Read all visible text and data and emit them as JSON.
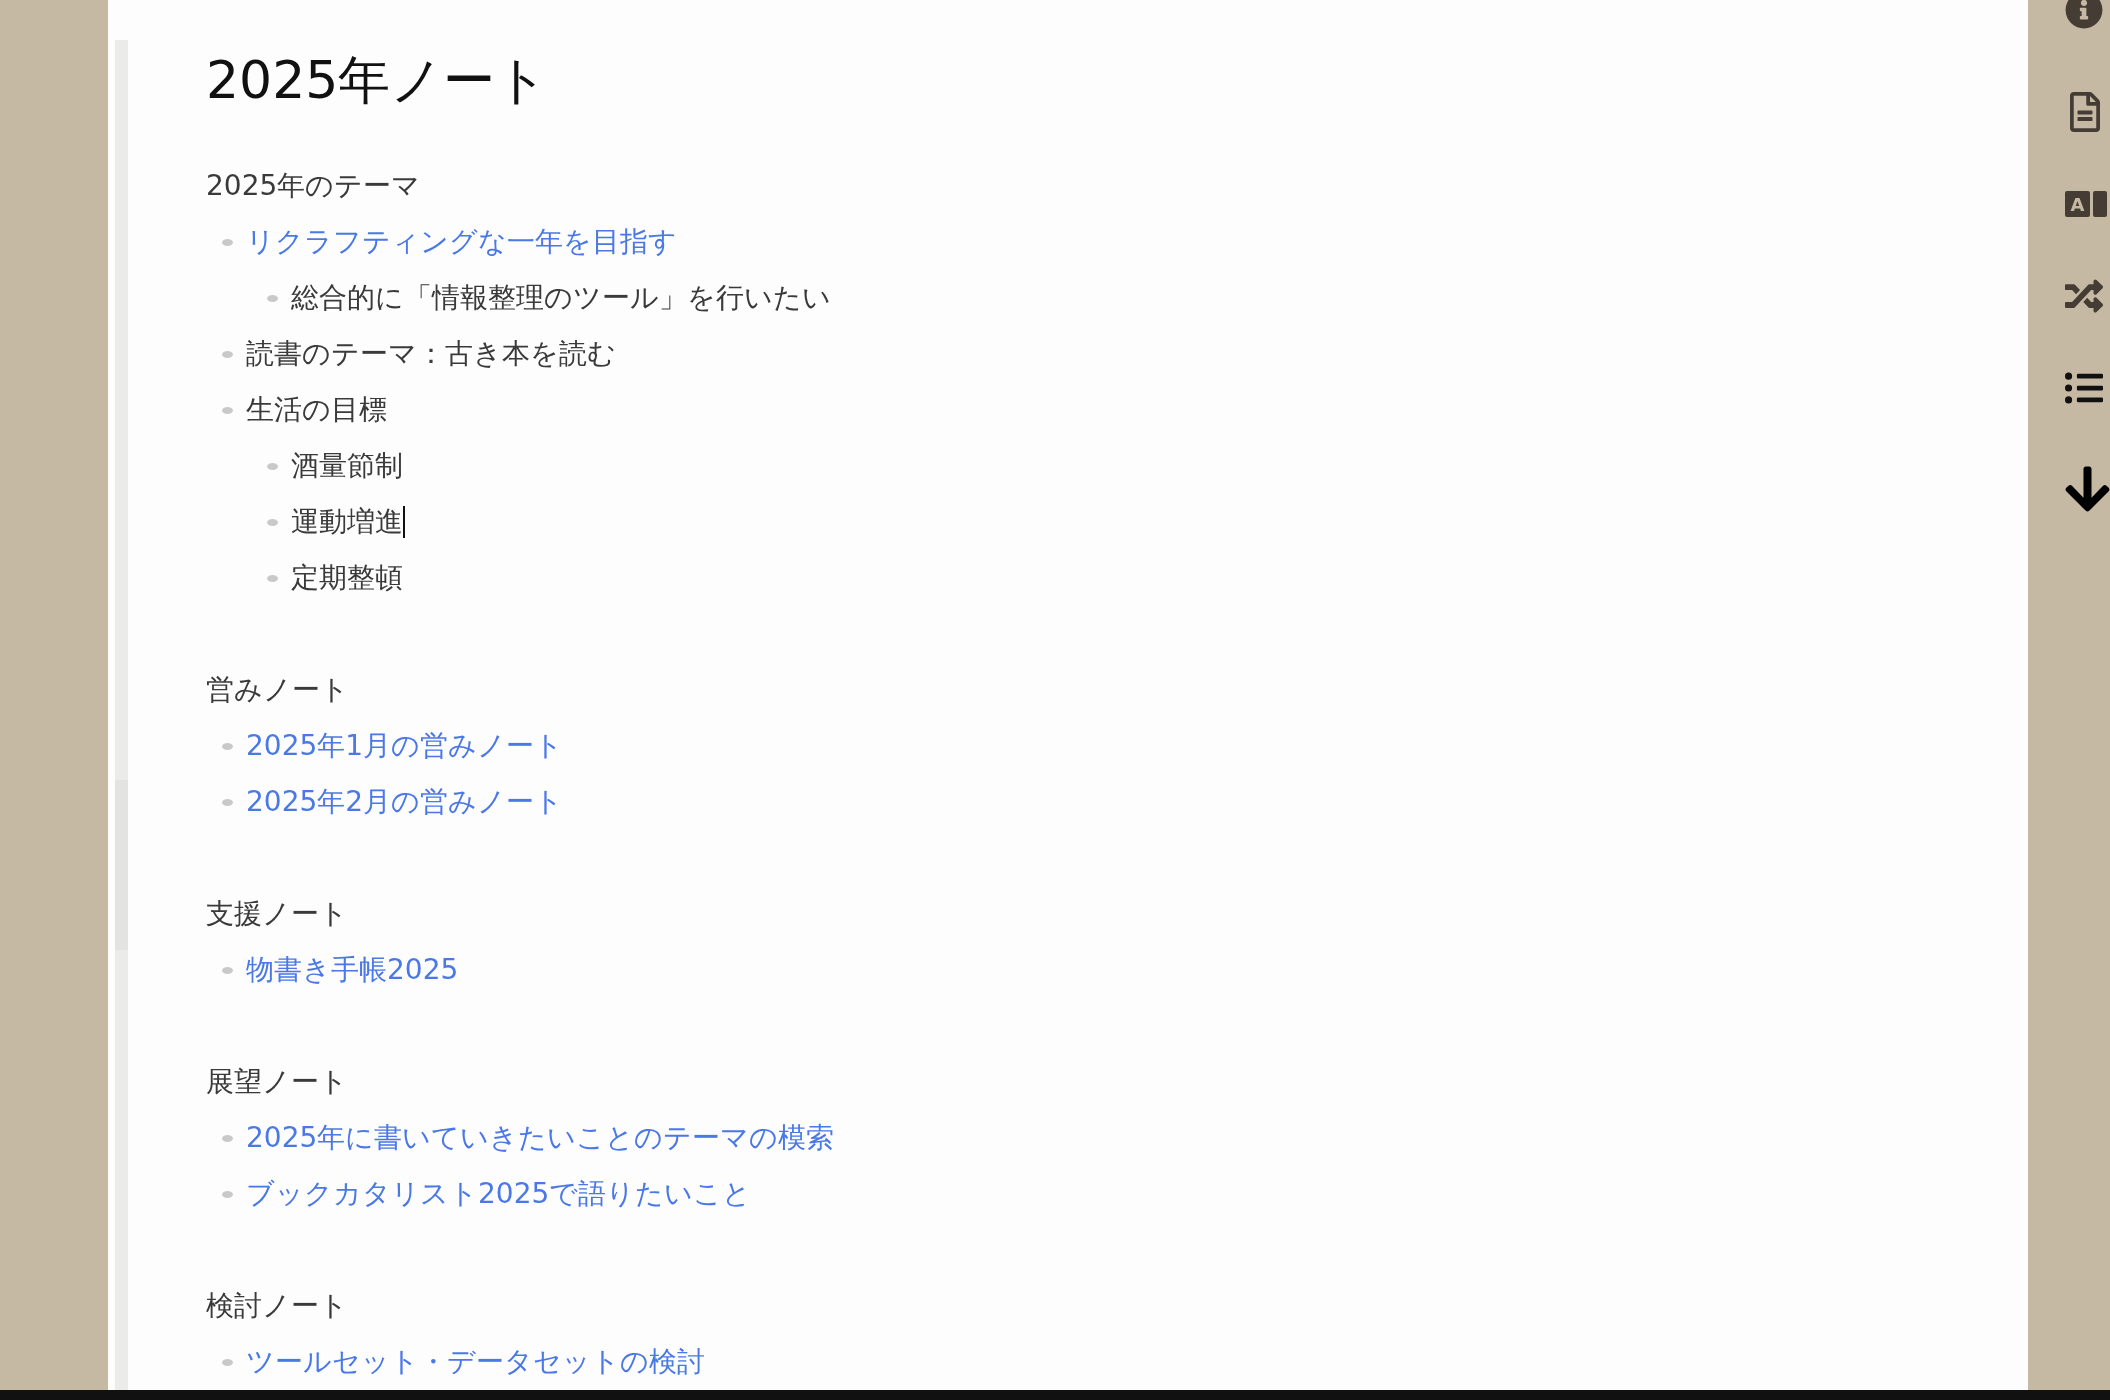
{
  "title": "2025年ノート",
  "translate_button": {
    "label": "A"
  },
  "sections": [
    {
      "heading": "2025年のテーマ",
      "items": [
        {
          "text": "リクラフティングな一年を目指す",
          "kind": "link",
          "children": [
            {
              "text": "総合的に「情報整理のツール」を行いたい",
              "kind": "text"
            }
          ]
        },
        {
          "text": "読書のテーマ：古き本を読む",
          "kind": "text"
        },
        {
          "text": "生活の目標",
          "kind": "text",
          "children": [
            {
              "text": "酒量節制",
              "kind": "text"
            },
            {
              "text": "運動増進",
              "kind": "text",
              "caret": true
            },
            {
              "text": "定期整頓",
              "kind": "text"
            }
          ]
        }
      ]
    },
    {
      "heading": "営みノート",
      "items": [
        {
          "text": "2025年1月の営みノート",
          "kind": "link"
        },
        {
          "text": "2025年2月の営みノート",
          "kind": "link"
        }
      ]
    },
    {
      "heading": "支援ノート",
      "items": [
        {
          "text": "物書き手帳2025",
          "kind": "link"
        }
      ]
    },
    {
      "heading": "展望ノート",
      "items": [
        {
          "text": "2025年に書いていきたいことのテーマの模索",
          "kind": "link"
        },
        {
          "text": "ブックカタリスト2025で語りたいこと",
          "kind": "link"
        }
      ]
    },
    {
      "heading": "検討ノート",
      "items": [
        {
          "text": "ツールセット・データセットの検討",
          "kind": "link"
        }
      ]
    }
  ]
}
